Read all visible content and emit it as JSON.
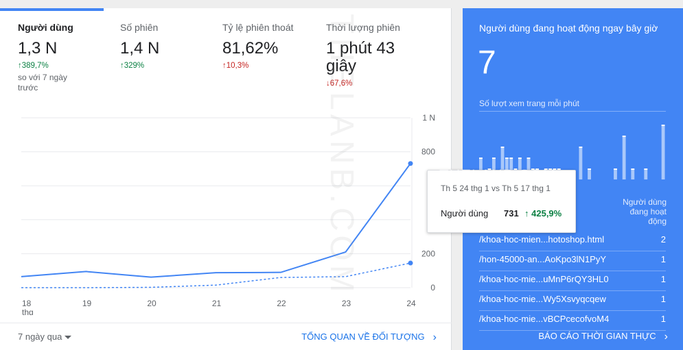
{
  "metrics": [
    {
      "label": "Người dùng",
      "value": "1,3 N",
      "delta": "389,7%",
      "delta_dir": "up",
      "delta_color": "#0b8043",
      "compare": "so với 7 ngày trước"
    },
    {
      "label": "Số phiên",
      "value": "1,4 N",
      "delta": "329%",
      "delta_dir": "up",
      "delta_color": "#0b8043"
    },
    {
      "label": "Tỷ lệ phiên thoát",
      "value": "81,62%",
      "delta": "10,3%",
      "delta_dir": "up",
      "delta_color": "#c5221f"
    },
    {
      "label": "Thời lượng phiên",
      "value": "1 phút 43 giây",
      "delta": "67,6%",
      "delta_dir": "down",
      "delta_color": "#c5221f"
    }
  ],
  "chart_data": {
    "type": "line",
    "categories": [
      "18 thg",
      "19",
      "20",
      "21",
      "22",
      "23",
      "24"
    ],
    "y_tick_labels": [
      "0",
      "200",
      "",
      "",
      "800",
      "1 N"
    ],
    "ylim": [
      0,
      1000
    ],
    "series": [
      {
        "values": [
          65,
          95,
          62,
          88,
          90,
          210,
          731
        ],
        "color": "#4285f4",
        "style": "solid"
      },
      {
        "values": [
          0,
          0,
          2,
          15,
          60,
          65,
          145
        ],
        "color": "#4285f4",
        "style": "dashed"
      }
    ],
    "grid": true,
    "highlight_index": 6
  },
  "tooltip": {
    "title": "Th 5 24 thg 1 vs Th 5 17 thg 1",
    "row_label": "Người dùng",
    "row_value": "731",
    "row_delta": "425,9%"
  },
  "footer": {
    "range": "7 ngày qua",
    "link": "TỔNG QUAN VỀ ĐỐI TƯỢNG"
  },
  "realtime": {
    "title": "Người dùng đang hoạt động ngay bây giờ",
    "count": "7",
    "subtitle": "Số lượt xem trang mỗi phút",
    "bars": [
      2,
      0,
      1,
      2,
      0,
      3,
      2,
      2,
      1,
      2,
      0,
      2,
      1,
      1,
      0,
      1,
      1,
      1,
      1,
      0,
      0,
      0,
      0,
      3,
      0,
      1,
      0,
      0,
      0,
      0,
      0,
      1,
      0,
      4,
      0,
      1,
      0,
      0,
      1,
      0,
      0,
      0,
      5
    ],
    "col_header": "Người dùng đang hoạt động",
    "pages": [
      {
        "path": "/khoa-hoc-mien...hotoshop.html",
        "count": "2"
      },
      {
        "path": "/hon-45000-an...AoKpo3lN1PyY",
        "count": "1"
      },
      {
        "path": "/khoa-hoc-mie...uMnP6rQY3HL0",
        "count": "1"
      },
      {
        "path": "/khoa-hoc-mie...Wy5Xsvyqcqew",
        "count": "1"
      },
      {
        "path": "/khoa-hoc-mie...vBCPcecofvoM4",
        "count": "1"
      }
    ],
    "footer_link": "BÁO CÁO THỜI GIAN THỰC",
    "bg_color": "#4285f4"
  },
  "watermark": "THELANB.COM"
}
